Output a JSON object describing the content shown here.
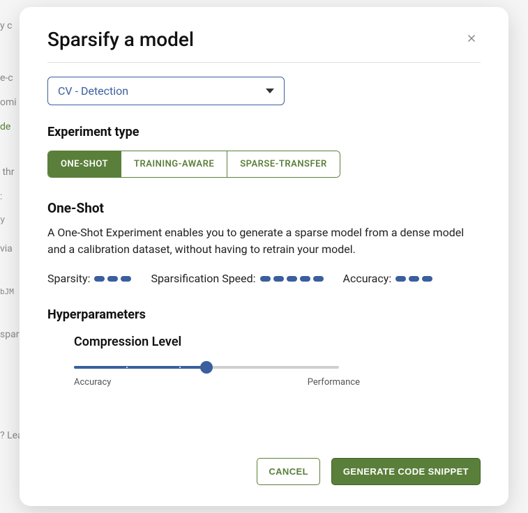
{
  "modal": {
    "title": "Sparsify a model",
    "select": {
      "value": "CV - Detection"
    },
    "experiment_type": {
      "heading": "Experiment type",
      "tabs": [
        {
          "label": "ONE-SHOT",
          "active": true
        },
        {
          "label": "TRAINING-AWARE",
          "active": false
        },
        {
          "label": "SPARSE-TRANSFER",
          "active": false
        }
      ]
    },
    "exp_desc": {
      "heading": "One-Shot",
      "text": "A One-Shot Experiment enables you to generate a sparse model from a dense model and a calibration dataset, without having to retrain your model."
    },
    "metrics": {
      "sparsity": {
        "label": "Sparsity:",
        "pills": 3
      },
      "speed": {
        "label": "Sparsification Speed:",
        "pills": 5
      },
      "accuracy": {
        "label": "Accuracy:",
        "pills": 3
      }
    },
    "hyper": {
      "heading": "Hyperparameters",
      "slider": {
        "label": "Compression Level",
        "left": "Accuracy",
        "right": "Performance",
        "value": 50
      }
    },
    "footer": {
      "cancel": "CANCEL",
      "primary": "GENERATE CODE SNIPPET"
    }
  }
}
